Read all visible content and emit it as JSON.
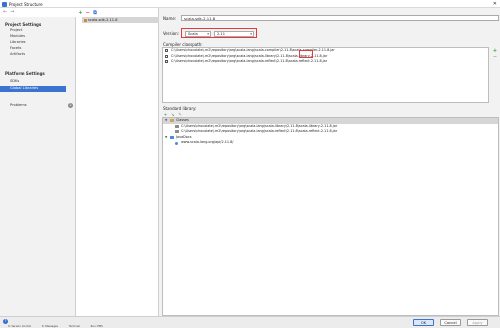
{
  "window": {
    "title": "Project Structure",
    "close_glyph": "✕"
  },
  "nav": {
    "back": "←",
    "forward": "→"
  },
  "sidebar": {
    "project_settings_header": "Project Settings",
    "project_settings_items": [
      "Project",
      "Modules",
      "Libraries",
      "Facets",
      "Artifacts"
    ],
    "platform_settings_header": "Platform Settings",
    "platform_settings_items": [
      "SDKs",
      "Global Libraries"
    ],
    "selected_item": "Global Libraries",
    "problems_label": "Problems",
    "problems_count": "2"
  },
  "libraries": {
    "toolbar": [
      "+",
      "−",
      "⧉"
    ],
    "items": [
      "scala-sdk-2.11.8"
    ],
    "selected": "scala-sdk-2.11.8"
  },
  "details": {
    "name_label": "Name:",
    "name_value": "scala-sdk-2.11.8",
    "version_label": "Version:",
    "version_selects": [
      "Scala",
      "2.11"
    ],
    "compiler_classpath_label": "Compiler classpath:",
    "compiler_classpath": [
      "C:\\Users\\chocolate\\.m2\\repository\\org\\scala-lang\\scala-compiler\\2.11.8\\scala-compiler-2.11.8.jar",
      "C:\\Users\\chocolate\\.m2\\repository\\org\\scala-lang\\scala-library\\2.11.8\\scala-library-2.11.8.jar",
      "C:\\Users\\chocolate\\.m2\\repository\\org\\scala-lang\\scala-reflect\\2.11.8\\scala-reflect-2.11.8.jar"
    ],
    "classpath_tools": [
      "+",
      "−"
    ],
    "standard_library_label": "Standard library:",
    "std_tools": [
      "+",
      "↘",
      "✎"
    ],
    "classes_label": "Classes",
    "classes": [
      "C:\\Users\\chocolate\\.m2\\repository\\org\\scala-lang\\scala-library\\2.11.8\\scala-library-2.11.8.jar",
      "C:\\Users\\chocolate\\.m2\\repository\\org\\scala-lang\\scala-reflect\\2.11.8\\scala-reflect-2.11.8.jar"
    ],
    "javadocs_label": "JavaDocs",
    "javadocs": [
      "www.scala-lang.org/api/2.11.8/"
    ]
  },
  "footer": {
    "help": "?",
    "ok": "OK",
    "cancel": "Cancel",
    "apply": "Apply"
  },
  "statusbar": [
    "9: Version Control",
    "6: Messages",
    "Terminal",
    "Run: EMS"
  ]
}
